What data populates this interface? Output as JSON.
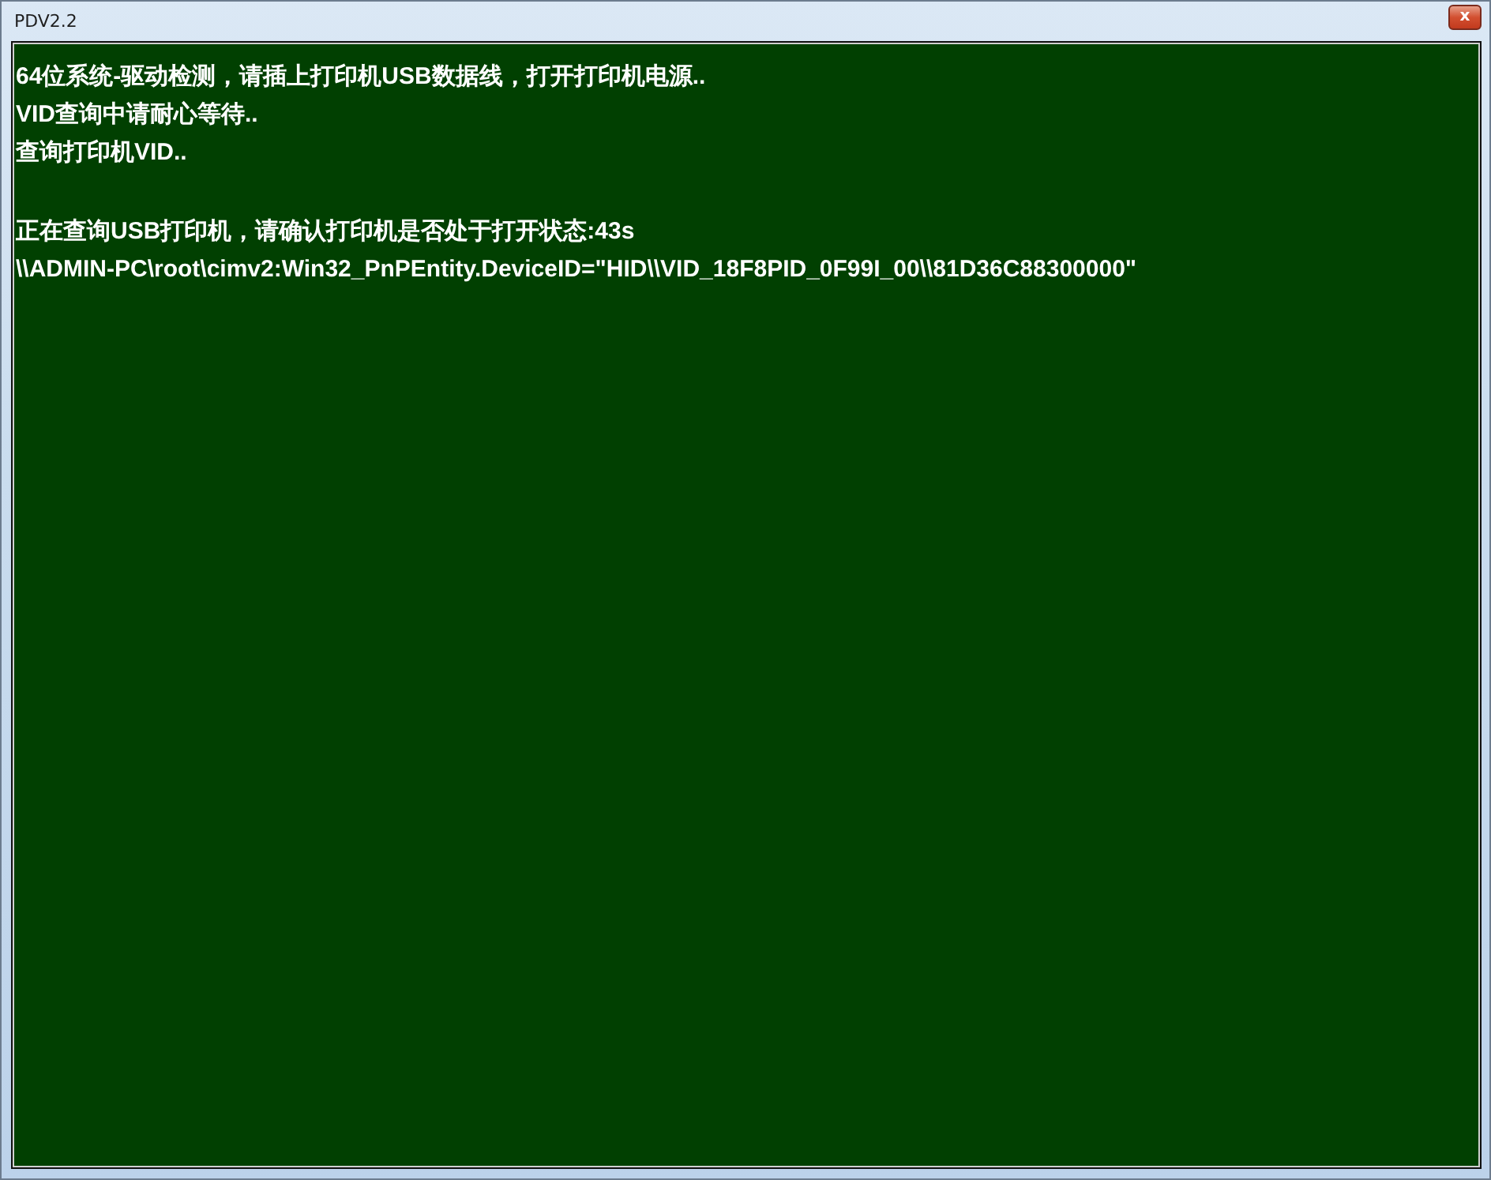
{
  "window": {
    "title": "PDV2.2",
    "close_button": "x"
  },
  "console": {
    "paragraphs": [
      [
        "64位系统-驱动检测，请插上打印机USB数据线，打开打印机电源..",
        "VID查询中请耐心等待..",
        "查询打印机VID.."
      ],
      [
        "正在查询USB打印机，请确认打印机是否处于打开状态:43s",
        "\\\\ADMIN-PC\\root\\cimv2:Win32_PnPEntity.DeviceID=\"HID\\\\VID_18F8PID_0F99I_00\\\\81D36C88300000\""
      ]
    ]
  }
}
